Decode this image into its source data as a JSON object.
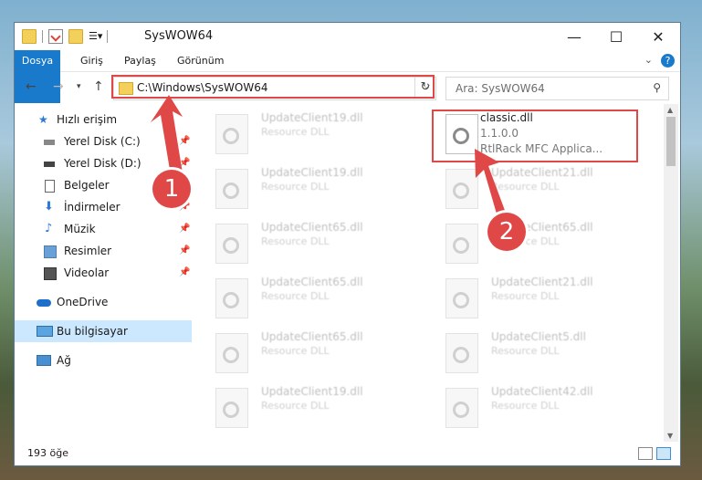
{
  "window": {
    "title": "SysWOW64"
  },
  "ribbon": {
    "tabs": [
      "Dosya",
      "Giriş",
      "Paylaş",
      "Görünüm"
    ],
    "help": "?"
  },
  "address": {
    "path": "C:\\Windows\\SysWOW64",
    "search_placeholder": "Ara: SysWOW64"
  },
  "nav": {
    "items": [
      {
        "label": "Hızlı erişim",
        "icon": "star-icon"
      },
      {
        "label": "Yerel Disk (C:)",
        "icon": "drive-icon"
      },
      {
        "label": "Yerel Disk (D:)",
        "icon": "drive-icon"
      },
      {
        "label": "Belgeler",
        "icon": "document-icon"
      },
      {
        "label": "İndirmeler",
        "icon": "download-icon"
      },
      {
        "label": "Müzik",
        "icon": "music-icon"
      },
      {
        "label": "Resimler",
        "icon": "picture-icon"
      },
      {
        "label": "Videolar",
        "icon": "video-icon"
      },
      {
        "label": "OneDrive",
        "icon": "cloud-icon"
      },
      {
        "label": "Bu bilgisayar",
        "icon": "computer-icon"
      },
      {
        "label": "Ağ",
        "icon": "network-icon"
      }
    ]
  },
  "files": [
    {
      "name": "UpdateClient19.dll",
      "type": "Resource DLL"
    },
    {
      "name": "classic.dll",
      "version": "1.1.0.0",
      "desc": "RtlRack MFC Applica..."
    },
    {
      "name": "UpdateClient19.dll",
      "type": "Resource DLL"
    },
    {
      "name": "UpdateClient21.dll",
      "type": "Resource DLL"
    },
    {
      "name": "UpdateClient65.dll",
      "type": "Resource DLL"
    },
    {
      "name": "UpdateClient65.dll",
      "type": "Resource DLL"
    },
    {
      "name": "UpdateClient65.dll",
      "type": "Resource DLL"
    },
    {
      "name": "UpdateClient21.dll",
      "type": "Resource DLL"
    },
    {
      "name": "UpdateClient65.dll",
      "type": "Resource DLL"
    },
    {
      "name": "UpdateClient5.dll",
      "type": "Resource DLL"
    },
    {
      "name": "UpdateClient19.dll",
      "type": "Resource DLL"
    },
    {
      "name": "UpdateClient42.dll",
      "type": "Resource DLL"
    }
  ],
  "status": {
    "count": "193 öğe"
  },
  "annotations": {
    "badge1": "1",
    "badge2": "2",
    "color": "#e04848"
  }
}
